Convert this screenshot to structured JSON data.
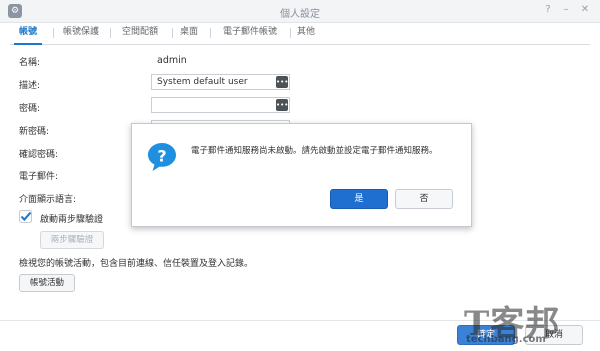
{
  "window": {
    "title": "個人設定",
    "help_glyph": "?",
    "minimize_glyph": "–",
    "close_glyph": "✕"
  },
  "tabs": [
    {
      "label": "帳號",
      "active": true
    },
    {
      "label": "帳號保護"
    },
    {
      "label": "空間配額"
    },
    {
      "label": "桌面"
    },
    {
      "label": "電子郵件帳號"
    },
    {
      "label": "其他"
    }
  ],
  "form": {
    "name_label": "名稱:",
    "name_value": "admin",
    "description_label": "描述:",
    "description_value": "System default user",
    "password_label": "密碼:",
    "new_password_label": "新密碼:",
    "confirm_password_label": "確認密碼:",
    "email_label": "電子郵件:",
    "language_label": "介面顯示語言:",
    "two_step_label": "啟動兩步驟驗證",
    "two_step_checked": true,
    "two_step_button": "兩步驟驗證",
    "activity_text": "檢視您的帳號活動，包含目前連線、信任裝置及登入記錄。",
    "activity_button": "帳號活動"
  },
  "footer": {
    "apply_label": "確定",
    "cancel_label": "取消"
  },
  "dialog": {
    "message": "電子郵件通知服務尚未啟動。請先啟動並設定電子郵件通知服務。",
    "yes_label": "是",
    "no_label": "否",
    "icon": "question-icon"
  },
  "watermark": {
    "brand": "T客邦",
    "domain": "techbang.com"
  },
  "colors": {
    "accent": "#1b77c9",
    "dialog_primary": "#1f6fd1"
  }
}
